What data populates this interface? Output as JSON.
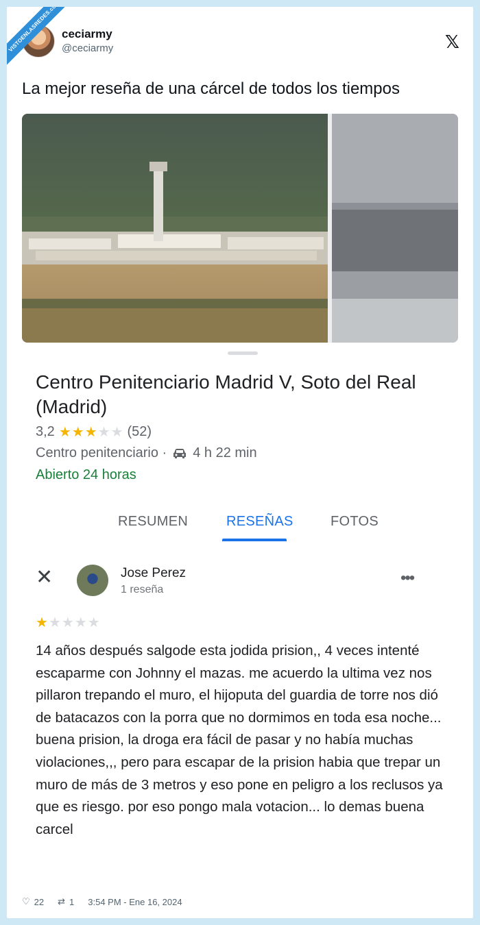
{
  "watermark": "VISTOENLASREDES.com",
  "tweet": {
    "user_name": "ceciarmy",
    "user_handle": "@ceciarmy",
    "text": "La mejor reseña de una cárcel de todos los tiempos",
    "likes": "22",
    "retweets": "1",
    "timestamp": "3:54 PM - Ene 16, 2024"
  },
  "place": {
    "title": "Centro Penitenciario Madrid V, Soto del Real (Madrid)",
    "rating": "3,2",
    "stars_filled": 3,
    "review_count": "(52)",
    "category": "Centro penitenciario ·",
    "travel_time": "4 h 22 min",
    "hours": "Abierto 24 horas"
  },
  "tabs": [
    {
      "label": "RESUMEN",
      "active": false
    },
    {
      "label": "RESEÑAS",
      "active": true
    },
    {
      "label": "FOTOS",
      "active": false
    }
  ],
  "review": {
    "author": "Jose Perez",
    "author_reviews": "1 reseña",
    "stars_filled": 1,
    "text": "14 años después salgode esta jodida prision,, 4 veces intenté escaparme con Johnny el mazas. me acuerdo la ultima vez nos pillaron trepando el muro, el hijoputa del guardia de torre nos dió de batacazos con la porra que no dormimos en toda esa noche... buena prision, la droga era fácil de pasar y no había muchas violaciones,,, pero para escapar de la prision habia que trepar un muro de más de 3 metros y eso pone en peligro a los reclusos ya que es riesgo.  por eso pongo mala votacion... lo demas buena carcel"
  },
  "icons": {
    "x_logo": "x-logo-icon",
    "car": "car-icon",
    "close": "close-icon",
    "more": "more-options-icon",
    "heart": "heart-icon",
    "retweet": "retweet-icon"
  },
  "colors": {
    "accent": "#1a73e8",
    "open": "#188038",
    "star": "#f4b400"
  }
}
